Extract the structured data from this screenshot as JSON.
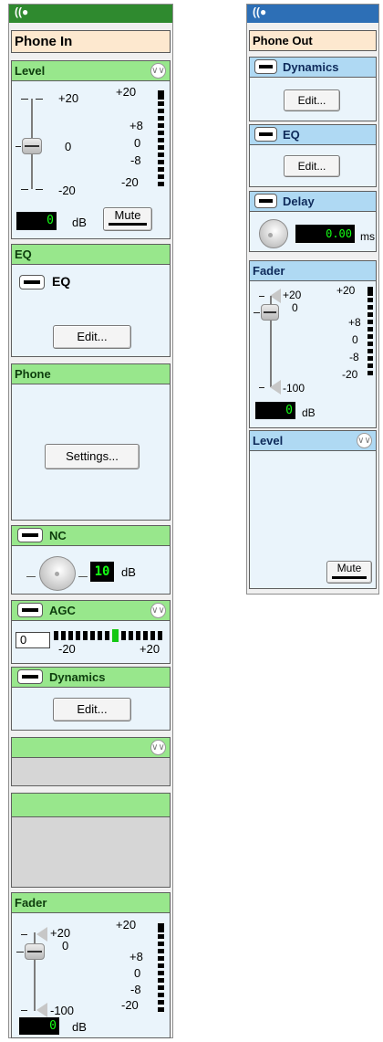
{
  "phone_in": {
    "title_icon": "((●",
    "name": "Phone In",
    "level": {
      "title": "Level",
      "scale_left": [
        "+20",
        "0",
        "-20"
      ],
      "scale_right": [
        "+20",
        "+8",
        "0",
        "-8",
        "-20"
      ],
      "value": "0",
      "unit": "dB",
      "mute": "Mute"
    },
    "eq": {
      "title": "EQ",
      "toggle_label": "EQ",
      "edit": "Edit..."
    },
    "phone": {
      "title": "Phone",
      "settings": "Settings..."
    },
    "nc": {
      "title": "NC",
      "value": "10",
      "unit": "dB"
    },
    "agc": {
      "title": "AGC",
      "value": "0",
      "min": "-20",
      "max": "+20"
    },
    "dynamics": {
      "title": "Dynamics",
      "edit": "Edit..."
    },
    "fader": {
      "title": "Fader",
      "scale_left": [
        "+20",
        "0",
        "-100"
      ],
      "scale_right": [
        "+20",
        "+8",
        "0",
        "-8",
        "-20"
      ],
      "value": "0",
      "unit": "dB"
    }
  },
  "phone_out": {
    "title_icon": "((●",
    "name": "Phone Out",
    "dynamics": {
      "title": "Dynamics",
      "edit": "Edit..."
    },
    "eq": {
      "title": "EQ",
      "edit": "Edit..."
    },
    "delay": {
      "title": "Delay",
      "value": "0.00",
      "unit": "ms"
    },
    "fader": {
      "title": "Fader",
      "scale_left": [
        "+20",
        "0",
        "-100"
      ],
      "scale_right": [
        "+20",
        "+8",
        "0",
        "-8",
        "-20"
      ],
      "value": "0",
      "unit": "dB"
    },
    "level": {
      "title": "Level",
      "mute": "Mute"
    }
  },
  "colors": {
    "green_header": "#98e78c",
    "blue_header": "#afd9f3",
    "name_box": "#fde8cf",
    "panel_bg": "#eaf4fb",
    "display_text": "#14ff14"
  }
}
